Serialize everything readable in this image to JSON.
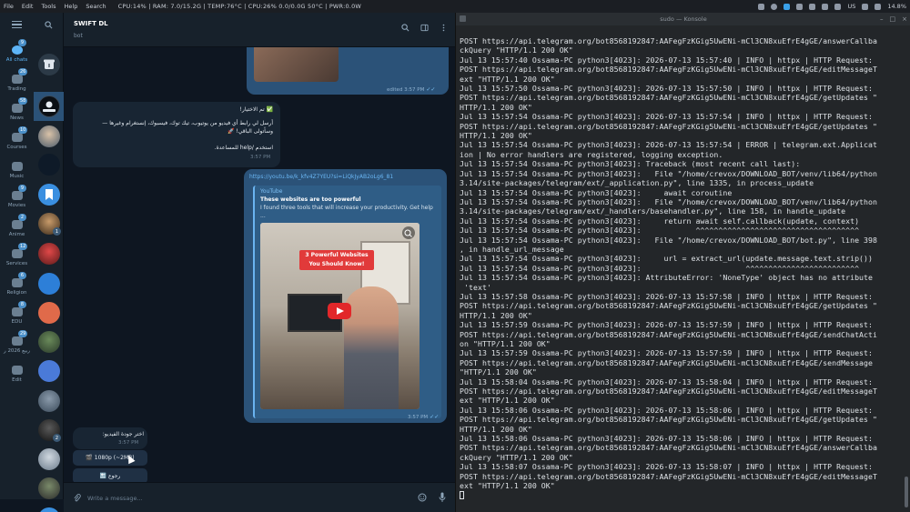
{
  "topbar": {
    "menu": [
      "File",
      "Edit",
      "Tools",
      "Help",
      "Search"
    ],
    "stats": "CPU:14% | RAM: 7.0/15.2G | TEMP:76°C | CPU:26% 0.0/0.0G 50°C | PWR:0.0W",
    "keyboard_layout": "US",
    "battery": "14.8%"
  },
  "telegram": {
    "folders": [
      {
        "label": "All chats",
        "badge": "9"
      },
      {
        "label": "Trading",
        "badge": "26"
      },
      {
        "label": "News",
        "badge": "58"
      },
      {
        "label": "Courses",
        "badge": "10"
      },
      {
        "label": "Music",
        "badge": ""
      },
      {
        "label": "Movies",
        "badge": "9"
      },
      {
        "label": "Anime",
        "badge": "2"
      },
      {
        "label": "Services",
        "badge": "12"
      },
      {
        "label": "Religion",
        "badge": "6"
      },
      {
        "label": "EDU",
        "badge": "8"
      },
      {
        "label": "ربيع 2026 ر",
        "badge": "29"
      },
      {
        "label": "Edit",
        "badge": ""
      }
    ],
    "avatar_badges": [
      "1",
      "2"
    ],
    "header": {
      "title": "SWIFT DL",
      "subtitle": "bot"
    },
    "messages": {
      "edited_meta": "edited 3:57 PM",
      "welcome_title": "✅ تم الاختيار!",
      "welcome_line1": "أرسل لي رابط أي فيديو من يوتيوب، تيك توك، فيسبوك، إنستغرام وغيرها —",
      "welcome_line2": "وسأتولى الباقي! 🚀",
      "welcome_line3": "استخدم /help للمساعدة.",
      "welcome_time": "3:57 PM",
      "link": "https://youtu.be/k_kfv4Z7YEU?si=LiQkJyAB2oLg6_81",
      "preview_site": "YouTube",
      "preview_title": "These websites are too powerful",
      "preview_desc": "I found three tools that will increase your productivity. Get help",
      "preview_more": "...",
      "banner_line1": "3 Powerful Websites",
      "banner_line2": "You Should Know!",
      "link_time": "3:57 PM",
      "quality_prompt": "اختر جودة الفيديو:",
      "quality_time": "3:57 PM",
      "btn_1080": "🎬 1080p (~2MB)",
      "btn_back": "🔙 رجوع"
    },
    "composer_placeholder": "Write a message..."
  },
  "terminal": {
    "title": "sudo — Konsole",
    "lines": [
      "POST https://api.telegram.org/bot8568192847:AAFegFzKGig5UwENi-mCl3CN8xuEfrE4gGE/answerCallba",
      "ckQuery \"HTTP/1.1 200 OK\"",
      "Jul 13 15:57:40 Ossama-PC python3[4023]: 2026-07-13 15:57:40 | INFO | httpx | HTTP Request:",
      "POST https://api.telegram.org/bot8568192847:AAFegFzKGig5UwENi-mCl3CN8xuEfrE4gGE/editMessageT",
      "ext \"HTTP/1.1 200 OK\"",
      "Jul 13 15:57:50 Ossama-PC python3[4023]: 2026-07-13 15:57:50 | INFO | httpx | HTTP Request:",
      "POST https://api.telegram.org/bot8568192847:AAFegFzKGig5UwENi-mCl3CN8xuEfrE4gGE/getUpdates \"",
      "HTTP/1.1 200 OK\"",
      "Jul 13 15:57:54 Ossama-PC python3[4023]: 2026-07-13 15:57:54 | INFO | httpx | HTTP Request:",
      "POST https://api.telegram.org/bot8568192847:AAFegFzKGig5UwENi-mCl3CN8xuEfrE4gGE/getUpdates \"",
      "HTTP/1.1 200 OK\"",
      "Jul 13 15:57:54 Ossama-PC python3[4023]: 2026-07-13 15:57:54 | ERROR | telegram.ext.Applicat",
      "ion | No error handlers are registered, logging exception.",
      "Jul 13 15:57:54 Ossama-PC python3[4023]: Traceback (most recent call last):",
      "Jul 13 15:57:54 Ossama-PC python3[4023]:   File \"/home/crevox/DOWNLOAD_BOT/venv/lib64/python",
      "3.14/site-packages/telegram/ext/_application.py\", line 1335, in process_update",
      "Jul 13 15:57:54 Ossama-PC python3[4023]:     await coroutine",
      "Jul 13 15:57:54 Ossama-PC python3[4023]:   File \"/home/crevox/DOWNLOAD_BOT/venv/lib64/python",
      "3.14/site-packages/telegram/ext/_handlers/basehandler.py\", line 158, in handle_update",
      "Jul 13 15:57:54 Ossama-PC python3[4023]:     return await self.callback(update, context)",
      "Jul 13 15:57:54 Ossama-PC python3[4023]:            ^^^^^^^^^^^^^^^^^^^^^^^^^^^^^^^^^^^^",
      "Jul 13 15:57:54 Ossama-PC python3[4023]:   File \"/home/crevox/DOWNLOAD_BOT/bot.py\", line 398",
      ", in handle_url_message",
      "Jul 13 15:57:54 Ossama-PC python3[4023]:     url = extract_url(update.message.text.strip())",
      "Jul 13 15:57:54 Ossama-PC python3[4023]:                       ^^^^^^^^^^^^^^^^^^^^^^^^^",
      "Jul 13 15:57:54 Ossama-PC python3[4023]: AttributeError: 'NoneType' object has no attribute",
      " 'text'",
      "Jul 13 15:57:58 Ossama-PC python3[4023]: 2026-07-13 15:57:58 | INFO | httpx | HTTP Request:",
      "POST https://api.telegram.org/bot8568192847:AAFegFzKGig5UwENi-mCl3CN8xuEfrE4gGE/getUpdates \"",
      "HTTP/1.1 200 OK\"",
      "Jul 13 15:57:59 Ossama-PC python3[4023]: 2026-07-13 15:57:59 | INFO | httpx | HTTP Request:",
      "POST https://api.telegram.org/bot8568192847:AAFegFzKGig5UwENi-mCl3CN8xuEfrE4gGE/sendChatActi",
      "on \"HTTP/1.1 200 OK\"",
      "Jul 13 15:57:59 Ossama-PC python3[4023]: 2026-07-13 15:57:59 | INFO | httpx | HTTP Request:",
      "POST https://api.telegram.org/bot8568192847:AAFegFzKGig5UwENi-mCl3CN8xuEfrE4gGE/sendMessage",
      "\"HTTP/1.1 200 OK\"",
      "Jul 13 15:58:04 Ossama-PC python3[4023]: 2026-07-13 15:58:04 | INFO | httpx | HTTP Request:",
      "POST https://api.telegram.org/bot8568192847:AAFegFzKGig5UwENi-mCl3CN8xuEfrE4gGE/editMessageT",
      "ext \"HTTP/1.1 200 OK\"",
      "Jul 13 15:58:06 Ossama-PC python3[4023]: 2026-07-13 15:58:06 | INFO | httpx | HTTP Request:",
      "POST https://api.telegram.org/bot8568192847:AAFegFzKGig5UwENi-mCl3CN8xuEfrE4gGE/getUpdates \"",
      "HTTP/1.1 200 OK\"",
      "Jul 13 15:58:06 Ossama-PC python3[4023]: 2026-07-13 15:58:06 | INFO | httpx | HTTP Request:",
      "POST https://api.telegram.org/bot8568192847:AAFegFzKGig5UwENi-mCl3CN8xuEfrE4gGE/answerCallba",
      "ckQuery \"HTTP/1.1 200 OK\"",
      "Jul 13 15:58:07 Ossama-PC python3[4023]: 2026-07-13 15:58:07 | INFO | httpx | HTTP Request:",
      "POST https://api.telegram.org/bot8568192847:AAFegFzKGig5UwENi-mCl3CN8xuEfrE4gGE/editMessageT",
      "ext \"HTTP/1.1 200 OK\""
    ]
  },
  "colors": {
    "accent": "#5eb5f7",
    "bubble_out": "#2b5278",
    "bubble_in": "#182533",
    "terminal_bg": "#232629"
  }
}
